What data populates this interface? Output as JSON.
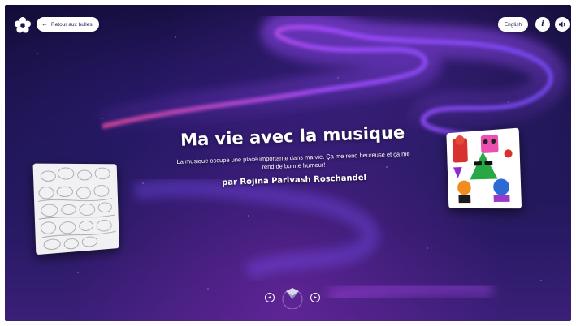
{
  "header": {
    "back_label": "Retour aux bulles",
    "language_label": "English"
  },
  "story": {
    "title": "Ma vie avec la musique",
    "description": "La musique occupe une place importante dans ma vie. Ça me rend heureuse et ça me rend de bonne humeur!",
    "author": "par Rojina Parivash Roschandel"
  },
  "icons": {
    "logo": "flower-logo-icon",
    "back": "arrow-left-icon",
    "info": "info-icon",
    "sound": "speaker-icon",
    "prev": "chevron-left-icon",
    "next": "chevron-right-icon",
    "center": "diamond-marker-icon"
  },
  "colors": {
    "background_top": "#0d0b2e",
    "background_bottom": "#3a1f78",
    "aurora_pink": "#e0489a",
    "aurora_violet": "#7a4cff",
    "button_bg": "#ffffff",
    "button_text": "#1b1650"
  }
}
